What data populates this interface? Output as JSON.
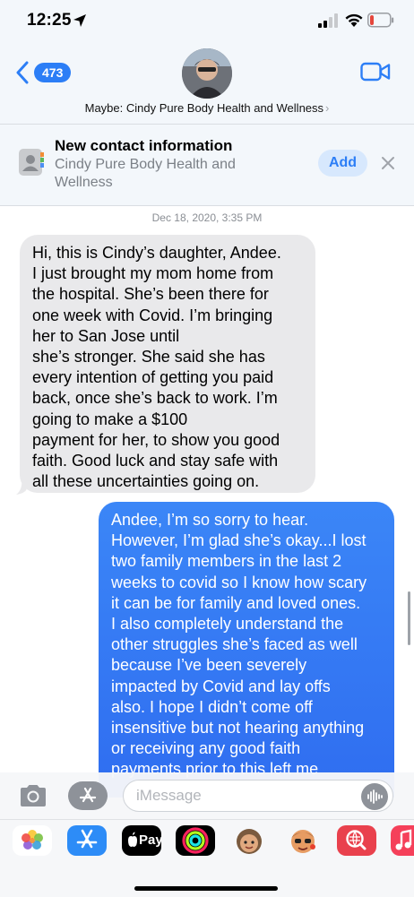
{
  "status_bar": {
    "time": "12:25",
    "icons": [
      "location-arrow-icon",
      "cellular-signal-icon",
      "wifi-icon",
      "battery-low-icon"
    ],
    "battery_color": "#e5463c"
  },
  "header": {
    "back_count": "473",
    "contact_name": "Maybe: Cindy Pure Body Health and Wellness",
    "chevron": "›",
    "accent": "#2c7ef6"
  },
  "banner": {
    "title": "New contact information",
    "subtitle": "Cindy Pure Body Health and\nWellness",
    "add_label": "Add"
  },
  "conversation": {
    "timestamp": "Dec 18, 2020, 3:35 PM",
    "messages": [
      {
        "direction": "incoming",
        "text": "Hi, this is Cindy’s daughter, Andee.\nI just brought my mom home from\nthe hospital. She’s been there for\none week with Covid.  I’m bringing\nher to San Jose until\nshe’s stronger. She said she has\nevery intention of getting you paid\nback, once she’s back to work. I’m\ngoing to make a $100\npayment for her,  to show you good\nfaith.  Good luck and stay safe with\nall these uncertainties going on."
      },
      {
        "direction": "outgoing",
        "text": "Andee, I’m so sorry to hear.\nHowever, I’m glad she’s okay...I lost\ntwo family members in the last 2\nweeks to covid so I know how scary\nit can be for family and loved ones.\nI also completely understand the\nother struggles she’s faced as well\nbecause I’ve been severely\nimpacted by Covid and lay offs\nalso. I hope I didn’t come off\ninsensitive but not hearing anything\nor receiving any good faith\npayments prior to this left me"
      }
    ],
    "incoming_color": "#e9e9eb",
    "outgoing_color": "#3079f4"
  },
  "composer": {
    "placeholder": "iMessage"
  },
  "app_drawer": {
    "apps": [
      {
        "name": "photos-app-icon"
      },
      {
        "name": "app-store-icon"
      },
      {
        "name": "apple-pay-icon",
        "label": "Pay"
      },
      {
        "name": "activity-icon"
      },
      {
        "name": "memoji-icon"
      },
      {
        "name": "memoji-stickers-icon"
      },
      {
        "name": "web-search-icon"
      },
      {
        "name": "music-icon"
      }
    ]
  }
}
